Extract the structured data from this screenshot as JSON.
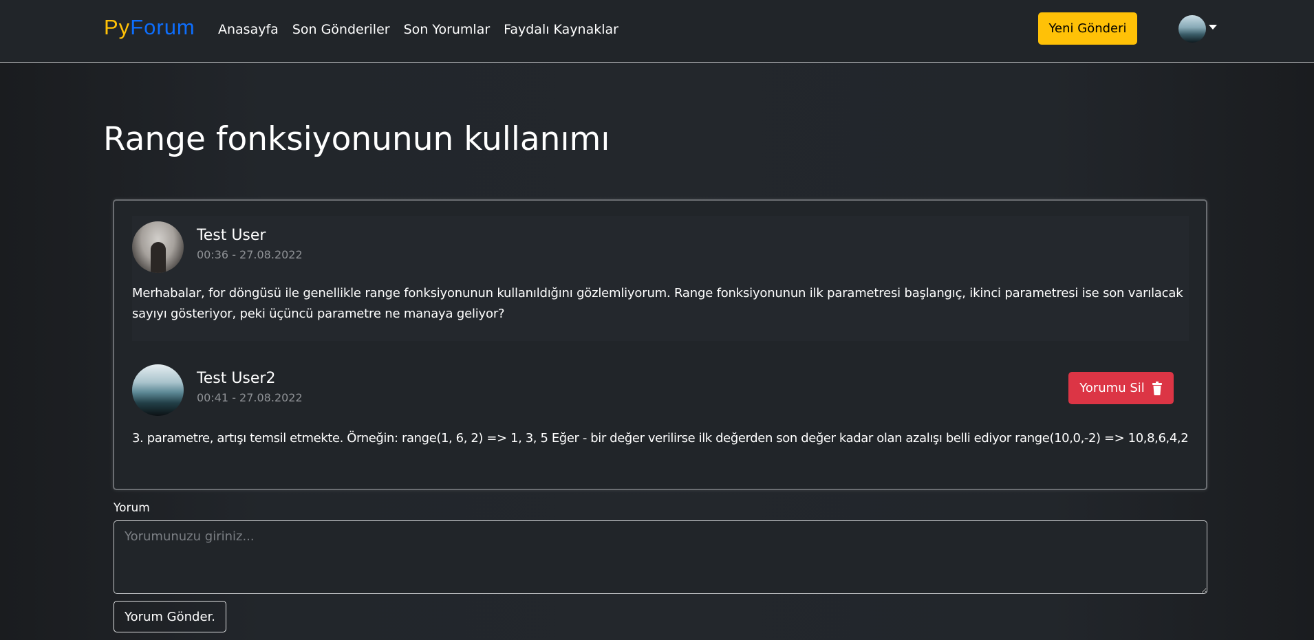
{
  "navbar": {
    "brand_py": "Py",
    "brand_forum": "Forum",
    "links": [
      "Anasayfa",
      "Son Gönderiler",
      "Son Yorumlar",
      "Faydalı Kaynaklar"
    ],
    "new_post_label": "Yeni Gönderi",
    "avatar_icon": "user-avatar-icon",
    "caret_icon": "caret-down-icon"
  },
  "page": {
    "title": "Range fonksiyonunun kullanımı"
  },
  "post": {
    "author": "Test User",
    "date": "00:36 - 27.08.2022",
    "text": "Merhabalar, for döngüsü ile genellikle range fonksiyonunun kullanıldığını gözlemliyorum. Range fonksiyonunun ilk parametresi başlangıç, ikinci parametresi ise son varılacak sayıyı gösteriyor, peki üçüncü parametre ne manaya geliyor?"
  },
  "comments": [
    {
      "author": "Test User2",
      "date": "00:41 - 27.08.2022",
      "text": "3. parametre, artışı temsil etmekte. Örneğin: range(1, 6, 2) => 1, 3, 5 Eğer - bir değer verilirse ilk değerden son değer kadar olan azalışı belli ediyor range(10,0,-2) => 10,8,6,4,2",
      "delete_label": "Yorumu Sil",
      "delete_icon": "trash-icon"
    }
  ],
  "comment_form": {
    "label": "Yorum",
    "placeholder": "Yorumunuzu giriniz...",
    "value": "",
    "submit_label": "Yorum Gönder."
  },
  "colors": {
    "brand_py": "#ffc107",
    "brand_forum": "#0d6efd",
    "new_post_button": "#ffc107",
    "delete_button": "#dc3545",
    "background": "#212529"
  }
}
